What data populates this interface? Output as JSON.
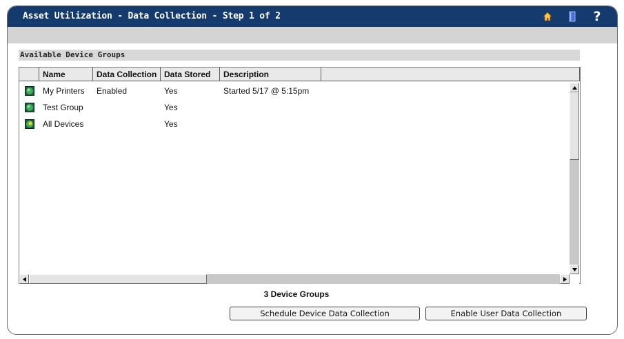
{
  "window": {
    "title": "Asset Utilization - Data Collection - Step 1 of 2",
    "icons": [
      "home-icon",
      "book-icon",
      "help-icon"
    ],
    "help_glyph": "?"
  },
  "section": {
    "title": "Available Device Groups"
  },
  "table": {
    "columns": [
      "",
      "Name",
      "Data Collection",
      "Data Stored",
      "Description",
      ""
    ],
    "rows": [
      {
        "icon": "group-icon",
        "name": "My Printers",
        "data_collection": "Enabled",
        "data_stored": "Yes",
        "description": "Started 5/17 @ 5:15pm"
      },
      {
        "icon": "group-icon",
        "name": "Test Group",
        "data_collection": "",
        "data_stored": "Yes",
        "description": ""
      },
      {
        "icon": "all-devices-icon",
        "name": "All Devices",
        "data_collection": "",
        "data_stored": "Yes",
        "description": ""
      }
    ]
  },
  "footer": {
    "count_label": "3 Device Groups",
    "schedule_button": "Schedule Device Data Collection",
    "enable_button": "Enable User Data Collection"
  },
  "colors": {
    "titlebar": "#143a6e",
    "subbar": "#d4d4d4",
    "section_header": "#d8d8d8"
  }
}
